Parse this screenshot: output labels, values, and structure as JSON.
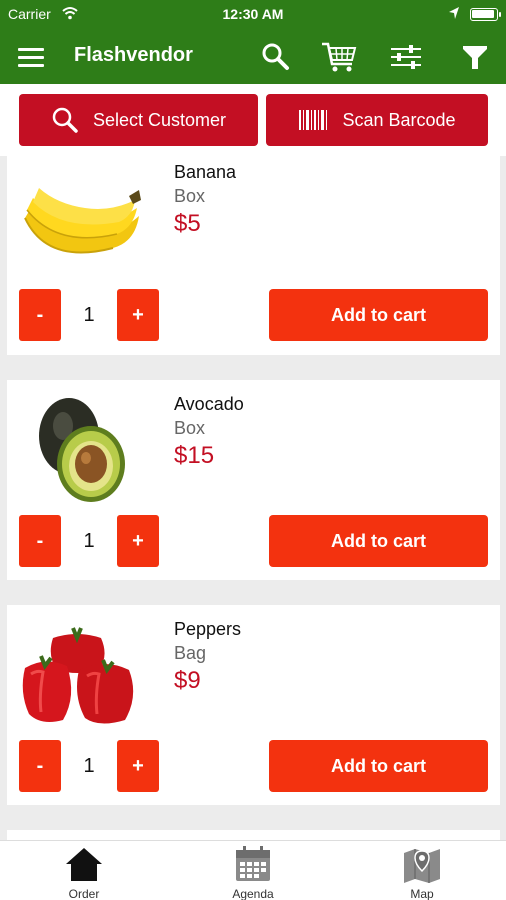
{
  "status_bar": {
    "carrier": "Carrier",
    "time": "12:30 AM"
  },
  "header": {
    "title": "Flashvendor",
    "icons": [
      "menu-icon",
      "search-icon",
      "cart-icon",
      "sliders-icon",
      "filter-icon"
    ]
  },
  "actions": {
    "select_customer": "Select Customer",
    "scan_barcode": "Scan Barcode"
  },
  "products": [
    {
      "name": "Banana",
      "unit": "Box",
      "price": "$5",
      "quantity": "1",
      "minus": "-",
      "plus": "+",
      "add_label": "Add to cart"
    },
    {
      "name": "Avocado",
      "unit": "Box",
      "price": "$15",
      "quantity": "1",
      "minus": "-",
      "plus": "+",
      "add_label": "Add to cart"
    },
    {
      "name": "Peppers",
      "unit": "Bag",
      "price": "$9",
      "quantity": "1",
      "minus": "-",
      "plus": "+",
      "add_label": "Add to cart"
    }
  ],
  "tabs": [
    {
      "label": "Order",
      "icon": "home-icon"
    },
    {
      "label": "Agenda",
      "icon": "calendar-icon"
    },
    {
      "label": "Map",
      "icon": "map-icon"
    }
  ],
  "colors": {
    "header": "#2e7d18",
    "action_button": "#c30f23",
    "cart_button": "#f3320f",
    "price": "#c30f23"
  }
}
